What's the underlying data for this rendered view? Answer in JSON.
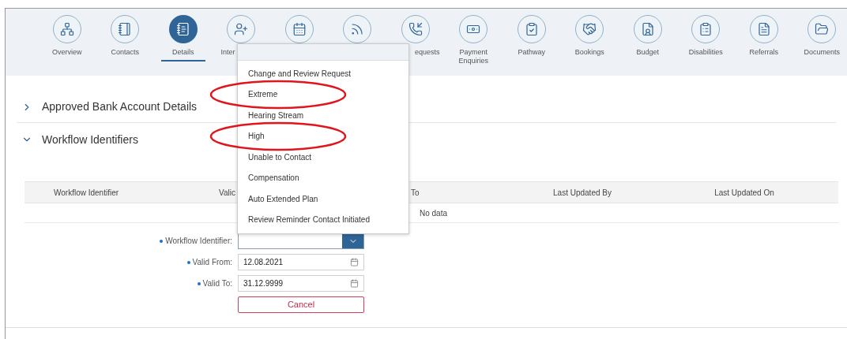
{
  "nav_tabs": [
    {
      "label": "Overview",
      "selected": false
    },
    {
      "label": "Contacts",
      "selected": false
    },
    {
      "label": "Details",
      "selected": true
    },
    {
      "label": "Inter",
      "selected": false
    },
    {
      "selected": false
    },
    {
      "selected": false
    },
    {
      "label": "equests",
      "selected": false
    },
    {
      "label": "Payment Enquiries",
      "selected": false
    },
    {
      "label": "Pathway",
      "selected": false
    },
    {
      "label": "Bookings",
      "selected": false
    },
    {
      "label": "Budget",
      "selected": false
    },
    {
      "label": "Disabilities",
      "selected": false
    },
    {
      "label": "Referrals",
      "selected": false
    },
    {
      "label": "Documents",
      "selected": false
    }
  ],
  "sections": [
    {
      "title": "Approved Bank Account Details",
      "expanded": false
    },
    {
      "title": "Workflow Identifiers",
      "expanded": true
    }
  ],
  "table": {
    "columns": [
      "Workflow Identifier",
      "Valic",
      "To",
      "Last Updated By",
      "Last Updated On"
    ],
    "empty_text": "No data"
  },
  "form": [
    {
      "kind": "select",
      "label": "Workflow Identifier:",
      "required": true
    },
    {
      "kind": "date",
      "label": "Valid From:",
      "required": true,
      "value": "12.08.2021"
    },
    {
      "kind": "date",
      "label": "Valid To:",
      "required": true,
      "value": "31.12.9999"
    }
  ],
  "cancel_button": "Cancel",
  "dropdown": [
    {
      "label": "Change and Review Request",
      "circled": false
    },
    {
      "label": "Extreme",
      "circled": true
    },
    {
      "label": "Hearing Stream",
      "circled": false
    },
    {
      "label": "High",
      "circled": true
    },
    {
      "label": "Unable to Contact",
      "circled": false
    },
    {
      "label": "Compensation",
      "circled": false
    },
    {
      "label": "Auto Extended Plan",
      "circled": false
    },
    {
      "label": "Review Reminder Contact Initiated",
      "circled": false
    }
  ]
}
